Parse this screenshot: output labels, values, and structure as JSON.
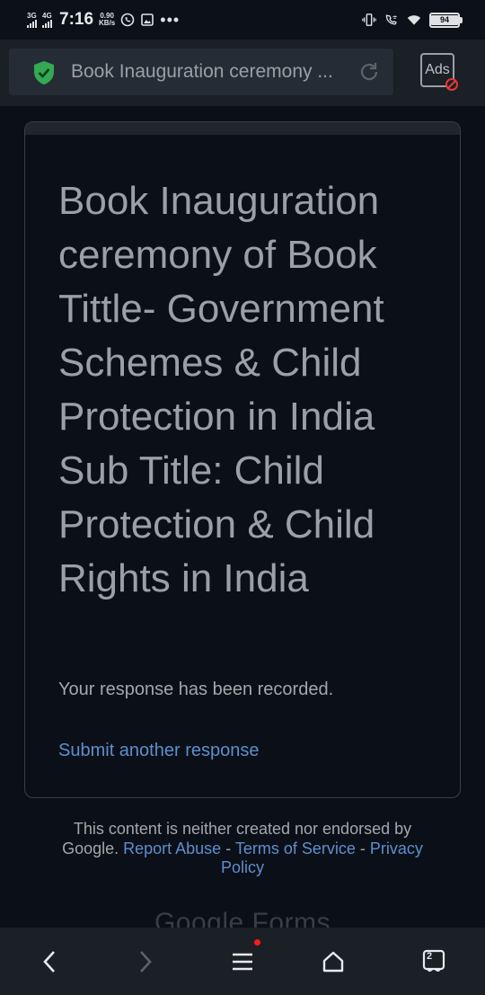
{
  "status_bar": {
    "net1": "3G",
    "net2": "4G",
    "time": "7:16",
    "speed_value": "0.90",
    "speed_unit": "KB/s",
    "battery": "94"
  },
  "browser": {
    "url_title": "Book Inauguration ceremony ...",
    "ads_label": "Ads",
    "tab_count": "2"
  },
  "form": {
    "title": "Book Inauguration ceremony of Book Tittle- Government Schemes & Child Protection in India Sub Title: Child Protection & Child Rights in India",
    "confirmation": "Your response has been recorded.",
    "submit_another": "Submit another response"
  },
  "footer": {
    "disclaimer": "This content is neither created nor endorsed by Google.",
    "report_abuse": "Report Abuse",
    "sep1": " - ",
    "terms": "Terms of Service",
    "sep2": " - ",
    "privacy": "Privacy Policy",
    "logo_text": "Google Forms"
  },
  "colors": {
    "background": "#0b0f17",
    "link": "#5d8fce",
    "secure_shield": "#34a853"
  }
}
